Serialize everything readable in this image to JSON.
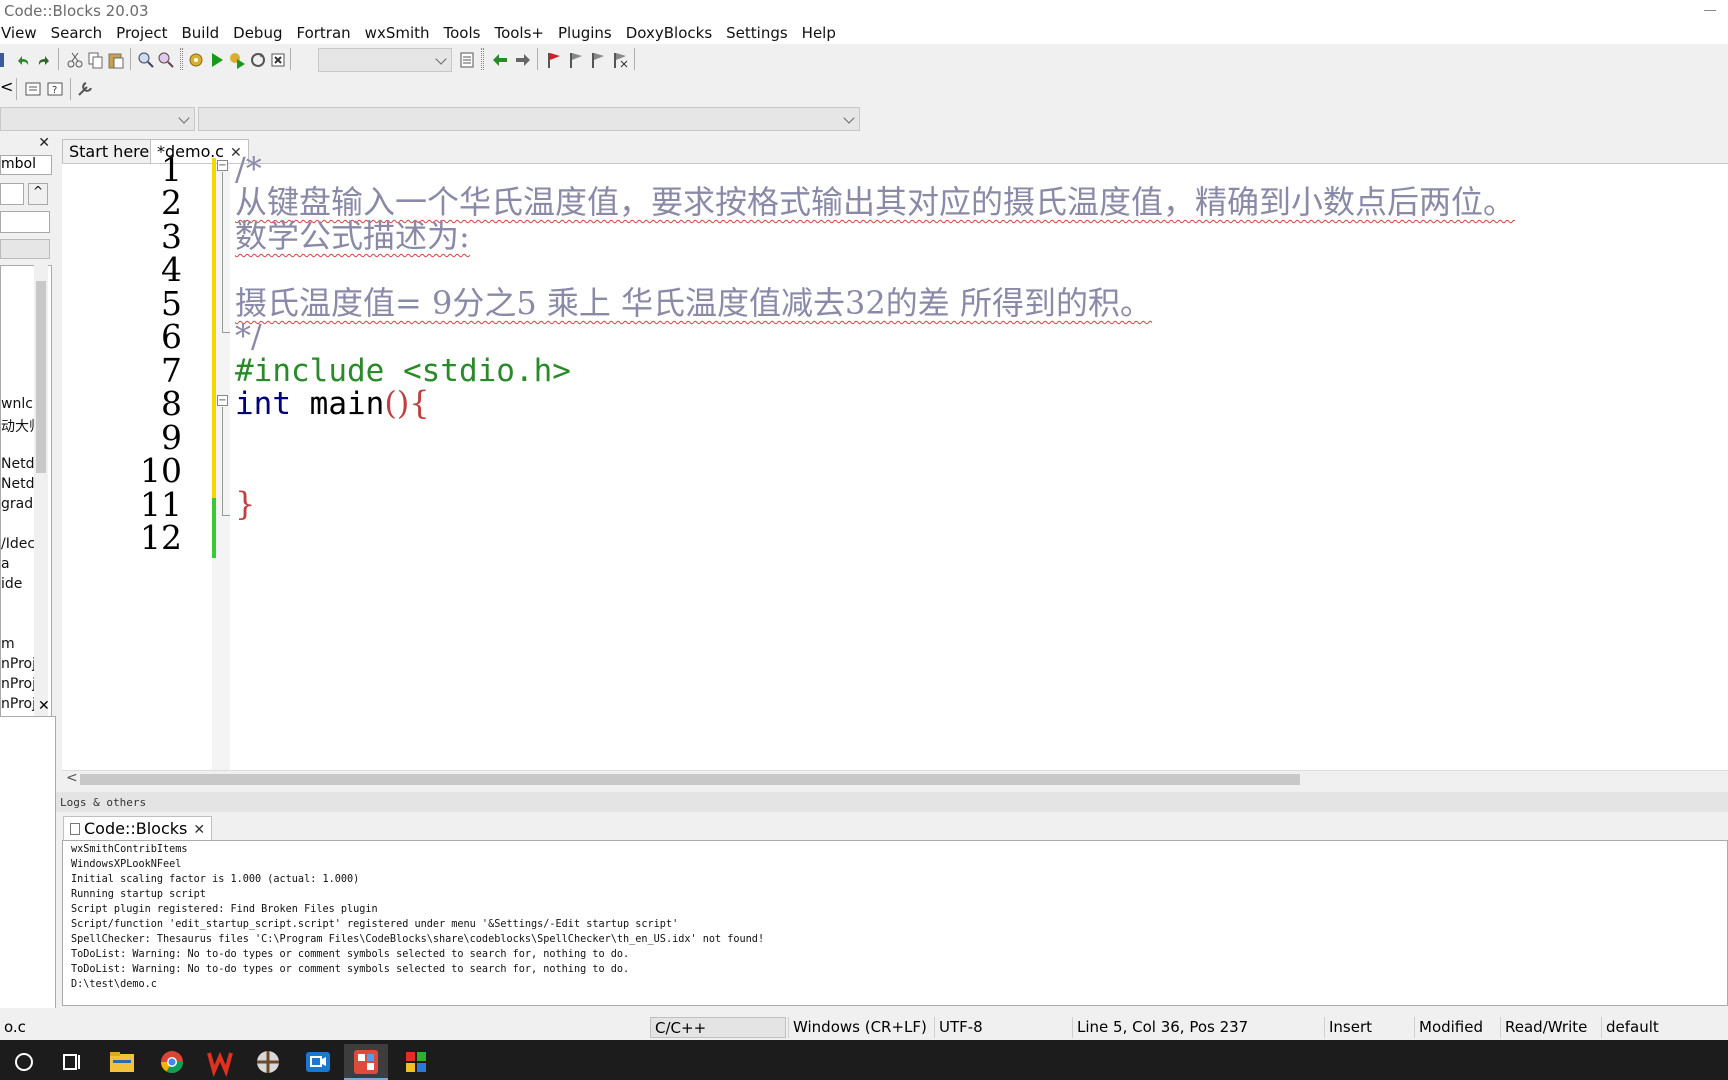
{
  "window": {
    "title": "Code::Blocks 20.03"
  },
  "menu": [
    "View",
    "Search",
    "Project",
    "Build",
    "Debug",
    "Fortran",
    "wxSmith",
    "Tools",
    "Tools+",
    "Plugins",
    "DoxyBlocks",
    "Settings",
    "Help"
  ],
  "left_panel": {
    "tab_label": "mbol",
    "tree_items": [
      "wnlc",
      "动大师",
      "",
      "Netdi",
      "Netdi",
      "grad",
      "",
      "/Idec",
      "a",
      "ide",
      "",
      "",
      "m",
      "nProj",
      "nProj",
      "nProj",
      "nProj",
      "nProj",
      "nProj",
      "nProj",
      "nProj"
    ]
  },
  "editor": {
    "tabs": [
      {
        "label": "Start here",
        "active": false
      },
      {
        "label": "*demo.c",
        "active": true
      }
    ],
    "line_numbers": [
      "1",
      "2",
      "3",
      "4",
      "5",
      "6",
      "7",
      "8",
      "9",
      "10",
      "11",
      "12"
    ],
    "code": {
      "l1": "/*",
      "l2": "从键盘输入一个华氏温度值，要求按格式输出其对应的摄氏温度值，精确到小数点后两位。",
      "l3": "数学公式描述为:",
      "l5": "摄氏温度值= 9分之5  乘上  华氏温度值减去32的差 所得到的积。",
      "l6": "*/",
      "l7": "#include <stdio.h>",
      "l8_kw": "int",
      "l8_id": " main",
      "l8_br": "(){",
      "l11": "}"
    }
  },
  "logs": {
    "header": "Logs & others",
    "tab_label": "Code::Blocks",
    "lines": [
      "wxSmithContribItems",
      "WindowsXPLookNFeel",
      "Initial scaling factor is 1.000 (actual: 1.000)",
      "Running startup script",
      "Script plugin registered: Find Broken Files plugin",
      "Script/function 'edit_startup_script.script' registered under menu '&Settings/-Edit startup script'",
      "SpellChecker: Thesaurus files 'C:\\Program Files\\CodeBlocks\\share\\codeblocks\\SpellChecker\\th_en_US.idx' not found!",
      "ToDoList: Warning: No to-do types or comment symbols selected to search for, nothing to do.",
      "ToDoList: Warning: No to-do types or comment symbols selected to search for, nothing to do.",
      "D:\\test\\demo.c"
    ]
  },
  "status": {
    "file": "o.c",
    "language": "C/C++",
    "eol": "Windows (CR+LF)",
    "encoding": "UTF-8",
    "position": "Line 5, Col 36, Pos 237",
    "mode": "Insert",
    "modified": "Modified",
    "access": "Read/Write",
    "profile": "default"
  },
  "taskbar": {
    "items": [
      "start-icon",
      "task-view-icon",
      "file-explorer-icon",
      "chrome-icon",
      "wps-icon",
      "app-icon",
      "video-app-icon",
      "codeblocks-icon",
      "app-grid-icon"
    ]
  },
  "colors": {
    "comment": "#8a8aa8",
    "preprocessor": "#2a8a2a",
    "keyword": "#00007f",
    "brace": "#c04040",
    "changed_line": "#f5d800",
    "saved_line": "#39c839"
  }
}
